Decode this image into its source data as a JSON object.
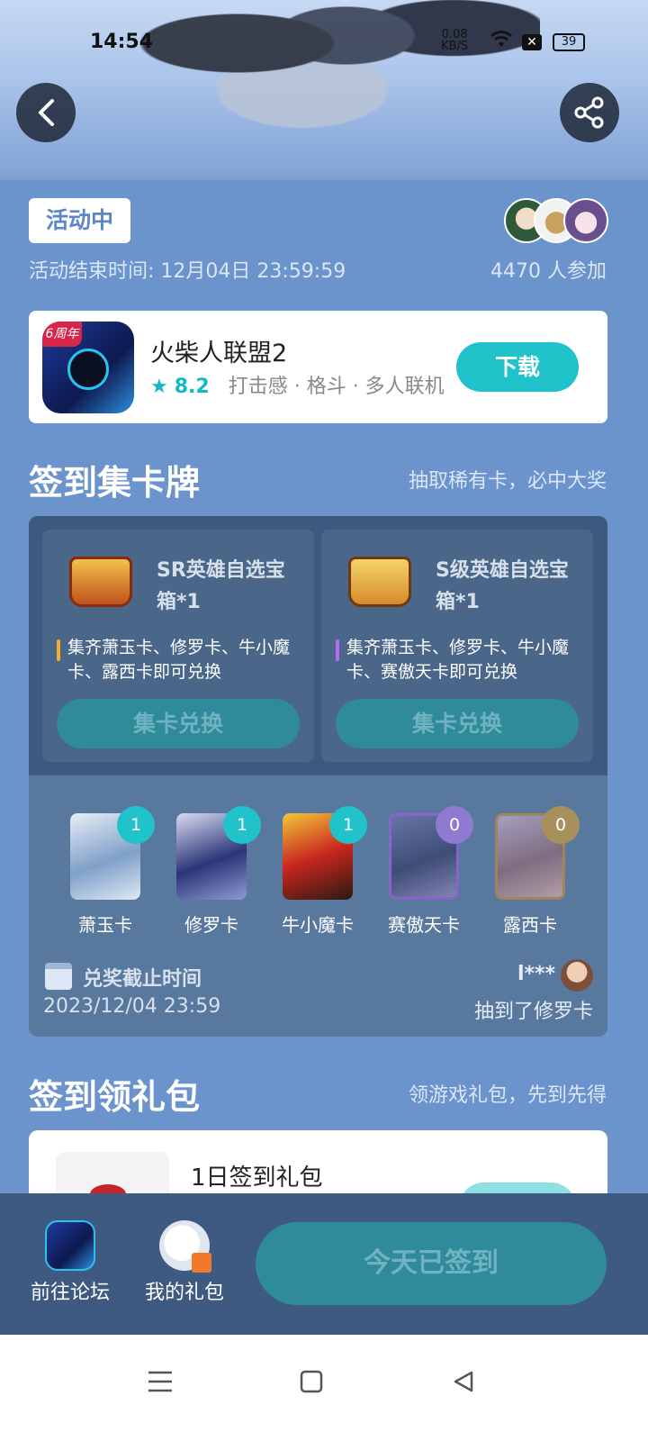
{
  "status_bar": {
    "time": "14:54",
    "speed_value": "0.08",
    "speed_unit": "KB/S",
    "battery": "39"
  },
  "header": {
    "back_icon": "chevron-left-icon",
    "share_icon": "share-icon"
  },
  "event": {
    "status": "活动中",
    "end_time": "活动结束时间: 12月04日 23:59:59",
    "participants": "4470 人参加"
  },
  "app": {
    "badge": "6周年",
    "name": "火柴人联盟2",
    "rating": "8.2",
    "tags": "打击感 · 格斗 · 多人联机",
    "download_label": "下载"
  },
  "card_section": {
    "title": "签到集卡牌",
    "subtitle": "抽取稀有卡，必中大奖",
    "rewards": [
      {
        "title": "SR英雄自选宝箱*1",
        "desc": "集齐萧玉卡、修罗卡、牛小魔卡、露西卡即可兑换",
        "button": "集卡兑换"
      },
      {
        "title": "S级英雄自选宝箱*1",
        "desc": "集齐萧玉卡、修罗卡、牛小魔卡、赛傲天卡即可兑换",
        "button": "集卡兑换"
      }
    ],
    "cards": [
      {
        "name": "萧玉卡",
        "count": "1"
      },
      {
        "name": "修罗卡",
        "count": "1"
      },
      {
        "name": "牛小魔卡",
        "count": "1"
      },
      {
        "name": "赛傲天卡",
        "count": "0"
      },
      {
        "name": "露西卡",
        "count": "0"
      }
    ],
    "deadline_label": "兑奖截止时间",
    "deadline_value": "2023/12/04 23:59",
    "winner_name": "l***",
    "winner_text": "抽到了修罗卡"
  },
  "gift_section": {
    "title": "签到领礼包",
    "subtitle": "领游戏礼包，先到先得",
    "first_gift": "1日签到礼包"
  },
  "bottom_bar": {
    "forum_label": "前往论坛",
    "gift_label": "我的礼包",
    "signed_label": "今天已签到"
  },
  "colors": {
    "accent": "#1fc3c9",
    "background": "#6b93cc",
    "panel": "#3c5a80"
  }
}
